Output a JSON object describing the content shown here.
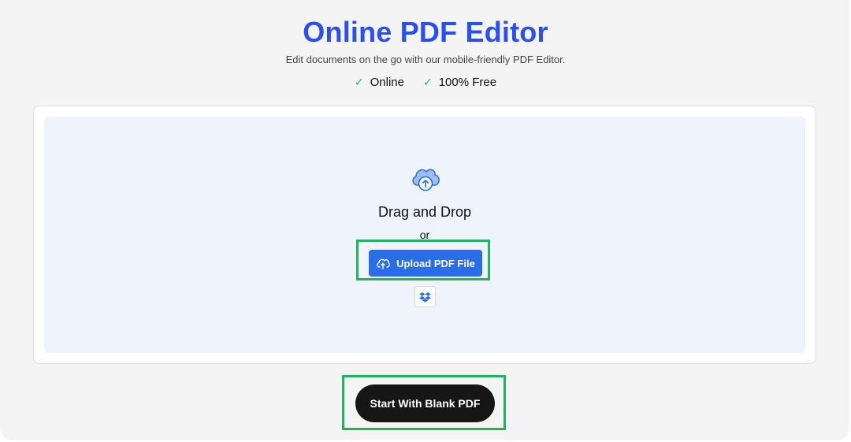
{
  "header": {
    "title": "Online PDF Editor",
    "subtitle": "Edit documents on the go with our mobile-friendly PDF Editor.",
    "features": [
      {
        "icon": "check-icon",
        "label": "Online"
      },
      {
        "icon": "check-icon",
        "label": "100% Free"
      }
    ]
  },
  "dropzone": {
    "icon": "cloud-upload-icon",
    "drag_label": "Drag and Drop",
    "or_label": "or",
    "upload_button_label": "Upload PDF File",
    "upload_button_icon": "cloud-upload-icon",
    "dropbox_icon": "dropbox-icon"
  },
  "actions": {
    "blank_button_label": "Start With Blank PDF"
  },
  "colors": {
    "title": "#2a4ff0",
    "check": "#22b35e",
    "upload_button": "#2a6de8",
    "dropzone_bg": "#eff4fc",
    "blank_button": "#161616",
    "highlight": "#22b35e"
  }
}
